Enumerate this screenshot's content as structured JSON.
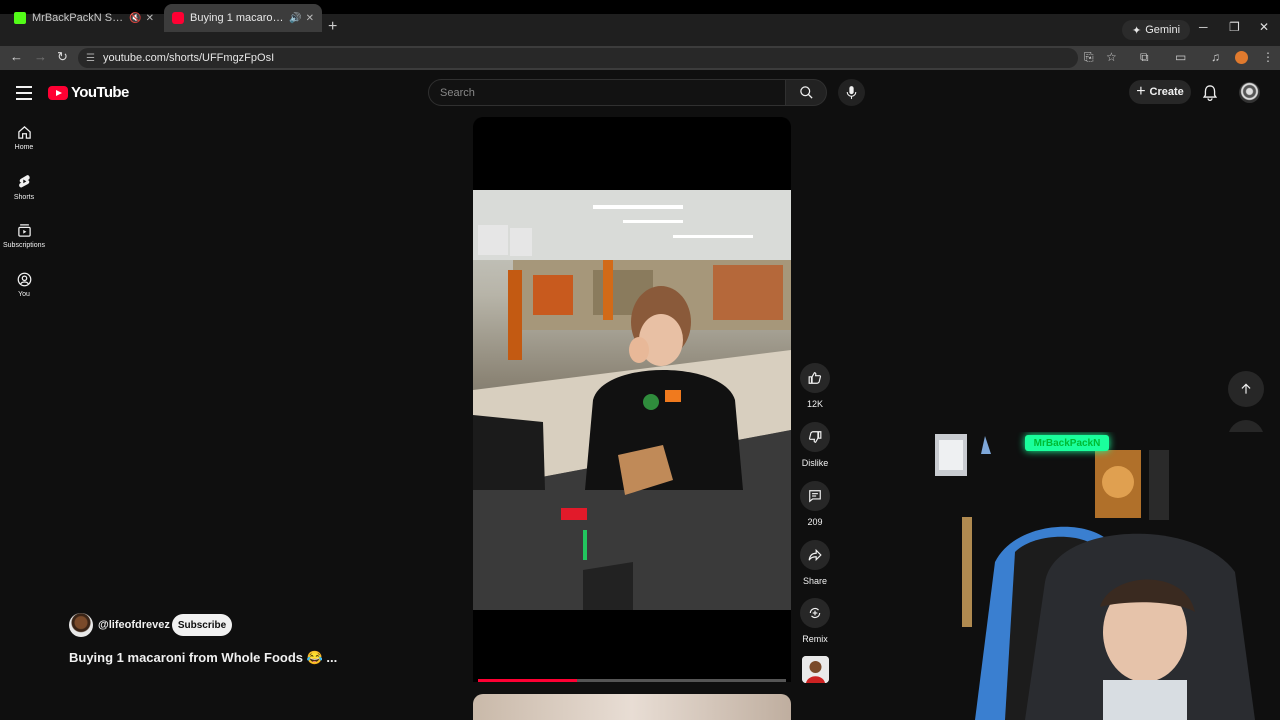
{
  "browser": {
    "tabs": [
      {
        "title": "MrBackPackN Stream - Wat",
        "favicon_color": "#53fc18",
        "active": false
      },
      {
        "title": "Buying 1 macaroni from Wh",
        "favicon_color": "#ff0033",
        "active": true
      }
    ],
    "url": "youtube.com/shorts/UFFmgzFpOsI",
    "gemini_label": "Gemini"
  },
  "youtube": {
    "logo_text": "YouTube",
    "search_placeholder": "Search",
    "create_label": "Create",
    "guide": [
      {
        "label": "Home",
        "icon": "home-icon"
      },
      {
        "label": "Shorts",
        "icon": "shorts-icon"
      },
      {
        "label": "Subscriptions",
        "icon": "subscriptions-icon"
      },
      {
        "label": "You",
        "icon": "you-icon"
      }
    ]
  },
  "short": {
    "channel": "@lifeofdrevez",
    "subscribe_label": "Subscribe",
    "title": "Buying 1 macaroni from Whole Foods 😂 ...",
    "progress_fraction": 0.32,
    "actions": {
      "like_count": "12K",
      "dislike_label": "Dislike",
      "comment_count": "209",
      "share_label": "Share",
      "remix_label": "Remix"
    }
  },
  "overlay": {
    "neon_sign": "MrBackPackN"
  },
  "colors": {
    "brand_red": "#ff0033",
    "background": "#0f0f0f",
    "kick_green": "#53fc18"
  }
}
